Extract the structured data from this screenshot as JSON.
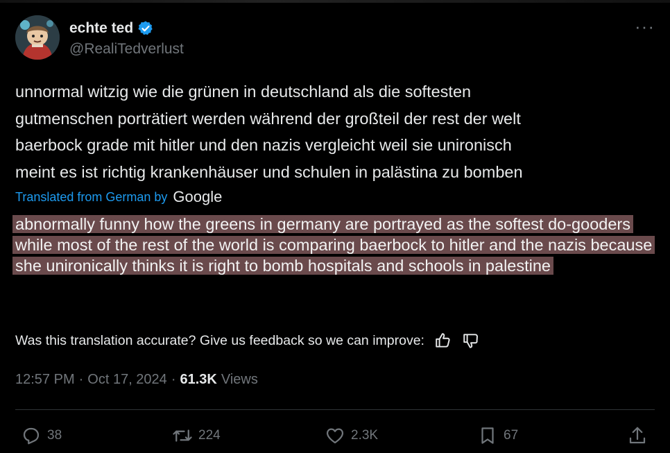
{
  "author": {
    "display_name": "echte ted",
    "handle": "@RealiTedverlust",
    "verified": true,
    "avatar_icon": "cartoon-avatar-icon"
  },
  "tweet": {
    "text": "unnormal witzig wie die grünen in deutschland als die softesten\ngutmenschen porträtiert werden während der großteil der rest der welt\nbaerbock grade mit hitler und den nazis vergleicht weil sie unironisch\nmeint es ist richtig krankenhäuser und schulen in palästina zu bomben",
    "translated_label": "Translated from German by",
    "translator": "Google",
    "translation": "abnormally funny how the greens in germany are portrayed as the softest do-gooders while most of the rest of the world is comparing baerbock to hitler and the nazis because she unironically thinks it is right to bomb hospitals and schools in palestine",
    "feedback_prompt": "Was this translation accurate? Give us feedback so we can improve:",
    "time": "12:57 PM",
    "date": "Oct 17, 2024",
    "views_count": "61.3K",
    "views_label": "Views",
    "separator": "·"
  },
  "actions": {
    "replies": "38",
    "reposts": "224",
    "likes": "2.3K",
    "bookmarks": "67"
  },
  "colors": {
    "background": "#000000",
    "text": "#e7e9ea",
    "muted": "#71767b",
    "link": "#1d9bf0",
    "highlight": "#6a4a4c",
    "verified": "#1d9bf0"
  }
}
